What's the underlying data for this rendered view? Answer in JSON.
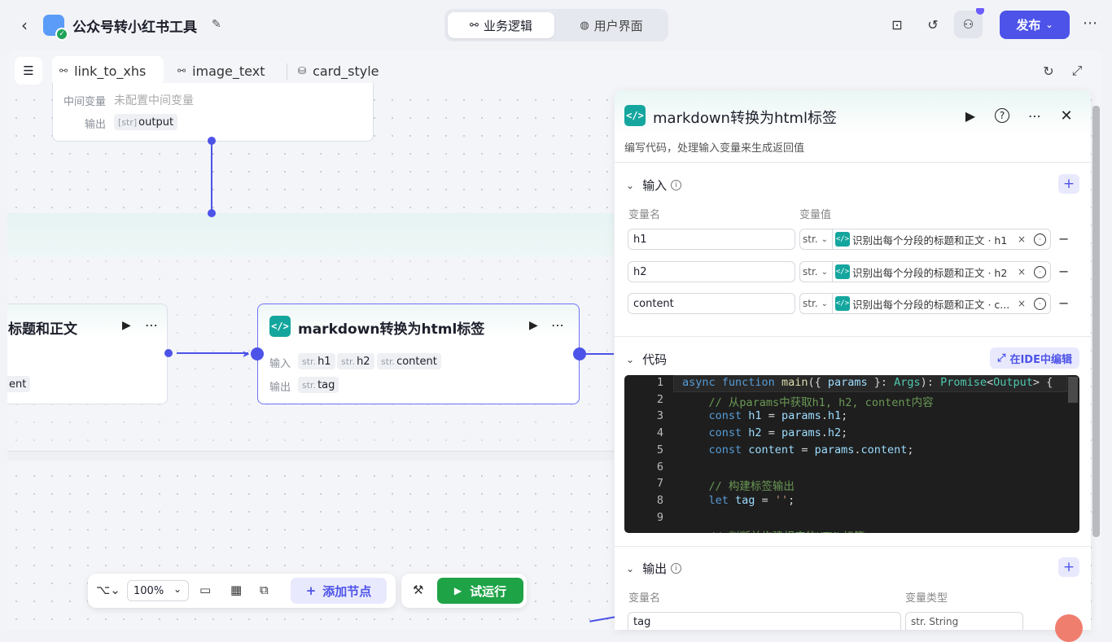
{
  "header": {
    "app_title": "公众号转小红书工具",
    "mode_tabs": [
      {
        "label": "业务逻辑",
        "active": true
      },
      {
        "label": "用户界面",
        "active": false
      }
    ],
    "publish_label": "发布"
  },
  "workflow_tabs": [
    {
      "label": "link_to_xhs",
      "active": true
    },
    {
      "label": "image_text",
      "active": false
    },
    {
      "label": "card_style",
      "active": false
    }
  ],
  "nodes": {
    "top_node": {
      "mid_var_label": "中间变量",
      "mid_var_value": "未配置中间变量",
      "output_label": "输出",
      "output_type": "[str]",
      "output_value": "output"
    },
    "left_node": {
      "title": "标题和正文",
      "output_partial": "ent"
    },
    "md_node": {
      "title": "markdown转换为html标签",
      "input_label": "输入",
      "inputs": [
        {
          "type": "str.",
          "name": "h1"
        },
        {
          "type": "str.",
          "name": "h2"
        },
        {
          "type": "str.",
          "name": "content"
        }
      ],
      "output_label": "输出",
      "outputs": [
        {
          "type": "str.",
          "name": "tag"
        }
      ]
    }
  },
  "toolbar": {
    "zoom": "100%",
    "add_node": "添加节点",
    "test_run": "试运行"
  },
  "panel": {
    "title": "markdown转换为html标签",
    "description": "编写代码，处理输入变量来生成返回值",
    "input_section": "输入",
    "col_var_name": "变量名",
    "col_var_value": "变量值",
    "inputs": [
      {
        "name": "h1",
        "type": "str.",
        "ref": "识别出每个分段的标题和正文 · h1"
      },
      {
        "name": "h2",
        "type": "str.",
        "ref": "识别出每个分段的标题和正文 · h2"
      },
      {
        "name": "content",
        "type": "str.",
        "ref": "识别出每个分段的标题和正文 · c..."
      }
    ],
    "code_section": "代码",
    "ide_button": "在IDE中编辑",
    "output_section": "输出",
    "out_col_name": "变量名",
    "out_col_type": "变量类型",
    "out_row_name": "tag",
    "out_row_type": "str. String"
  },
  "code_lines": [
    {
      "n": "1",
      "html": "<span class='kw'>async</span> <span class='kw'>function</span> <span class='fn'>main</span>({ <span class='vr'>params</span> }: <span class='ty'>Args</span>): <span class='ty'>Promise</span>&lt;<span class='ty'>Output</span>&gt; {"
    },
    {
      "n": "2",
      "html": "    <span class='cm'>// 从params中获取h1, h2, content内容</span>"
    },
    {
      "n": "3",
      "html": "    <span class='kw'>const</span> <span class='vr'>h1</span> = <span class='vr'>params</span>.<span class='vr'>h1</span>;"
    },
    {
      "n": "4",
      "html": "    <span class='kw'>const</span> <span class='vr'>h2</span> = <span class='vr'>params</span>.<span class='vr'>h2</span>;"
    },
    {
      "n": "5",
      "html": "    <span class='kw'>const</span> <span class='vr'>content</span> = <span class='vr'>params</span>.<span class='vr'>content</span>;"
    },
    {
      "n": "6",
      "html": ""
    },
    {
      "n": "7",
      "html": "    <span class='cm'>// 构建标签输出</span>"
    },
    {
      "n": "8",
      "html": "    <span class='kw'>let</span> <span class='vr'>tag</span> = <span class='st'>''</span>;"
    },
    {
      "n": "9",
      "html": ""
    },
    {
      "n": "",
      "html": "    <span class='cm'>// 判断并构建相应的HTML标签</span>"
    }
  ],
  "colors": {
    "accent": "#4d53e8",
    "code_icon": "#14a69e",
    "run_green": "#1fa347"
  }
}
